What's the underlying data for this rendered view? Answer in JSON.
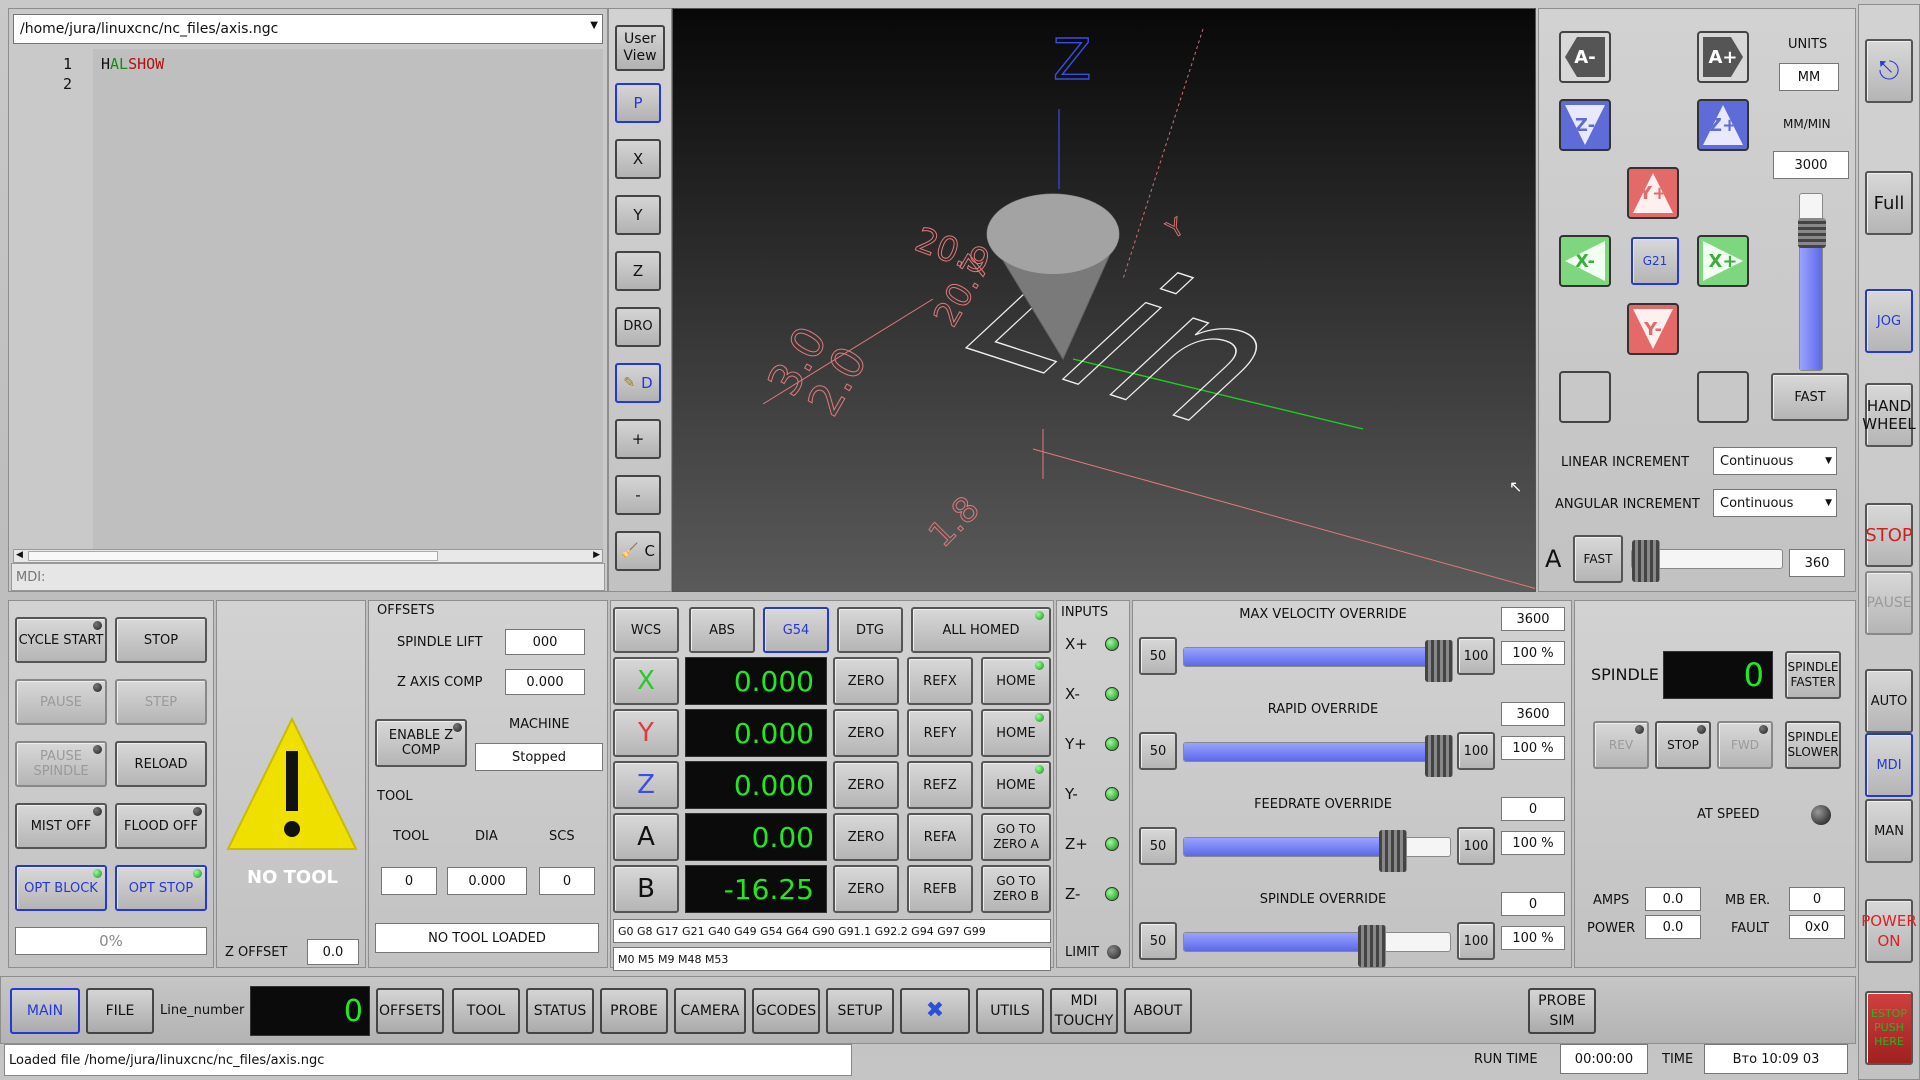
{
  "editor": {
    "file_path": "/home/jura/linuxcnc/nc_files/axis.ngc",
    "line1_num": "1",
    "line1_h": "H",
    "line1_al": "AL",
    "line1_show": "SHOW",
    "line2_num": "2",
    "mdi_placeholder": "MDI:"
  },
  "view_buttons": {
    "user_view": "User View",
    "p": "P",
    "x": "X",
    "y": "Y",
    "z": "Z",
    "dro": "DRO",
    "d": "D",
    "plus": "+",
    "minus": "-",
    "c": "C"
  },
  "preview": {
    "z_label": "Z",
    "y_label": "Y",
    "dim1": "20.9",
    "dim2": "20.7",
    "dim3": "3.0",
    "dim4": "2.0",
    "dim5": "1.8",
    "text": "Lin"
  },
  "jog": {
    "a_minus": "A-",
    "a_plus": "A+",
    "z_minus": "Z-",
    "z_plus": "Z+",
    "y_plus": "Y+",
    "y_minus": "Y-",
    "x_minus": "X-",
    "x_plus": "X+",
    "g21": "G21",
    "units_label": "UNITS",
    "units_value": "MM",
    "rate_label": "MM/MIN",
    "rate_value": "3000",
    "fast": "FAST",
    "linear_increment_label": "LINEAR INCREMENT",
    "linear_increment_value": "Continuous",
    "angular_increment_label": "ANGULAR INCREMENT",
    "angular_increment_value": "Continuous",
    "a_label": "A",
    "a_fast": "FAST",
    "a_value": "360",
    "rate_fraction": 0.8
  },
  "right_column": {
    "full": "Full",
    "jog": "JOG",
    "handwheel": "HAND WHEEL",
    "stop": "STOP",
    "pause": "PAUSE",
    "auto": "AUTO",
    "mdi": "MDI",
    "man": "MAN",
    "power_on": "POWER ON",
    "estop": "ESTOP PUSH HERE"
  },
  "program_control": {
    "cycle_start": "CYCLE START",
    "stop": "STOP",
    "pause": "PAUSE",
    "step": "STEP",
    "pause_spindle": "PAUSE SPINDLE",
    "reload": "RELOAD",
    "mist_off": "MIST OFF",
    "flood_off": "FLOOD OFF",
    "opt_block": "OPT BLOCK",
    "opt_stop": "OPT STOP",
    "progress": "0%"
  },
  "tool_warning": {
    "text": "NO TOOL",
    "z_offset_label": "Z OFFSET",
    "z_offset_value": "0.0"
  },
  "offsets": {
    "title": "OFFSETS",
    "spindle_lift_label": "SPINDLE LIFT",
    "spindle_lift_value": "000",
    "z_axis_comp_label": "Z AXIS COMP",
    "z_axis_comp_value": "0.000",
    "enable_z_comp": "ENABLE Z COMP",
    "machine_label": "MACHINE",
    "machine_value": "Stopped",
    "tool_title": "TOOL",
    "tool_col": "TOOL",
    "dia_col": "DIA",
    "scs_col": "SCS",
    "tool_value": "0",
    "dia_value": "0.000",
    "scs_value": "0",
    "no_tool_loaded": "NO TOOL LOADED"
  },
  "dro": {
    "wcs": "WCS",
    "abs": "ABS",
    "g54": "G54",
    "dtg": "DTG",
    "all_homed": "ALL HOMED",
    "axes": [
      {
        "name": "X",
        "value": "0.000",
        "zero": "ZERO",
        "ref": "REFX",
        "home": "HOME"
      },
      {
        "name": "Y",
        "value": "0.000",
        "zero": "ZERO",
        "ref": "REFY",
        "home": "HOME"
      },
      {
        "name": "Z",
        "value": "0.000",
        "zero": "ZERO",
        "ref": "REFZ",
        "home": "HOME"
      },
      {
        "name": "A",
        "value": "0.00",
        "zero": "ZERO",
        "ref": "REFA",
        "home": "GO TO ZERO A"
      },
      {
        "name": "B",
        "value": "-16.25",
        "zero": "ZERO",
        "ref": "REFB",
        "home": "GO TO ZERO B"
      }
    ],
    "gcodes": "G0 G8 G17 G21 G40 G49 G54 G64 G90 G91.1 G92.2 G94 G97 G99",
    "mcodes": "M0 M5 M9 M48 M53",
    "colors": {
      "x": "#22cc22",
      "y": "#e03a3a",
      "z": "#3a4ee0",
      "a": "#222222",
      "b": "#222222"
    }
  },
  "inputs": {
    "title": "INPUTS",
    "items": [
      "X+",
      "X-",
      "Y+",
      "Y-",
      "Z+",
      "Z-"
    ],
    "limit": "LIMIT"
  },
  "overrides": [
    {
      "title": "MAX VELOCITY OVERRIDE",
      "min": "50",
      "max": "100",
      "value": "3600",
      "percent": "100 %",
      "fraction": 0.95
    },
    {
      "title": "RAPID OVERRIDE",
      "min": "50",
      "max": "100",
      "value": "3600",
      "percent": "100 %",
      "fraction": 0.95
    },
    {
      "title": "FEEDRATE OVERRIDE",
      "min": "50",
      "max": "100",
      "value": "0",
      "percent": "100 %",
      "fraction": 0.78
    },
    {
      "title": "SPINDLE OVERRIDE",
      "min": "50",
      "max": "100",
      "value": "0",
      "percent": "100 %",
      "fraction": 0.7
    }
  ],
  "spindle": {
    "label": "SPINDLE",
    "rpm": "0",
    "faster": "SPINDLE FASTER",
    "slower": "SPINDLE SLOWER",
    "rev": "REV",
    "stop": "STOP",
    "fwd": "FWD",
    "at_speed": "AT SPEED",
    "amps_label": "AMPS",
    "amps_value": "0.0",
    "mb_er_label": "MB ER.",
    "mb_er_value": "0",
    "power_label": "POWER",
    "power_value": "0.0",
    "fault_label": "FAULT",
    "fault_value": "0x0"
  },
  "nav": {
    "main": "MAIN",
    "file": "FILE",
    "line_number_label": "Line_number",
    "line_number_value": "0",
    "offsets": "OFFSETS",
    "tool": "TOOL",
    "status": "STATUS",
    "probe": "PROBE",
    "camera": "CAMERA",
    "gcodes": "GCODES",
    "setup": "SETUP",
    "utils": "UTILS",
    "mdi_touchy": "MDI TOUCHY",
    "about": "ABOUT",
    "probe_sim": "PROBE SIM"
  },
  "statusbar": {
    "message": "Loaded file /home/jura/linuxcnc/nc_files/axis.ngc",
    "run_time_label": "RUN TIME",
    "run_time_value": "00:00:00",
    "time_label": "TIME",
    "time_value": "Вто 10:09 03"
  }
}
